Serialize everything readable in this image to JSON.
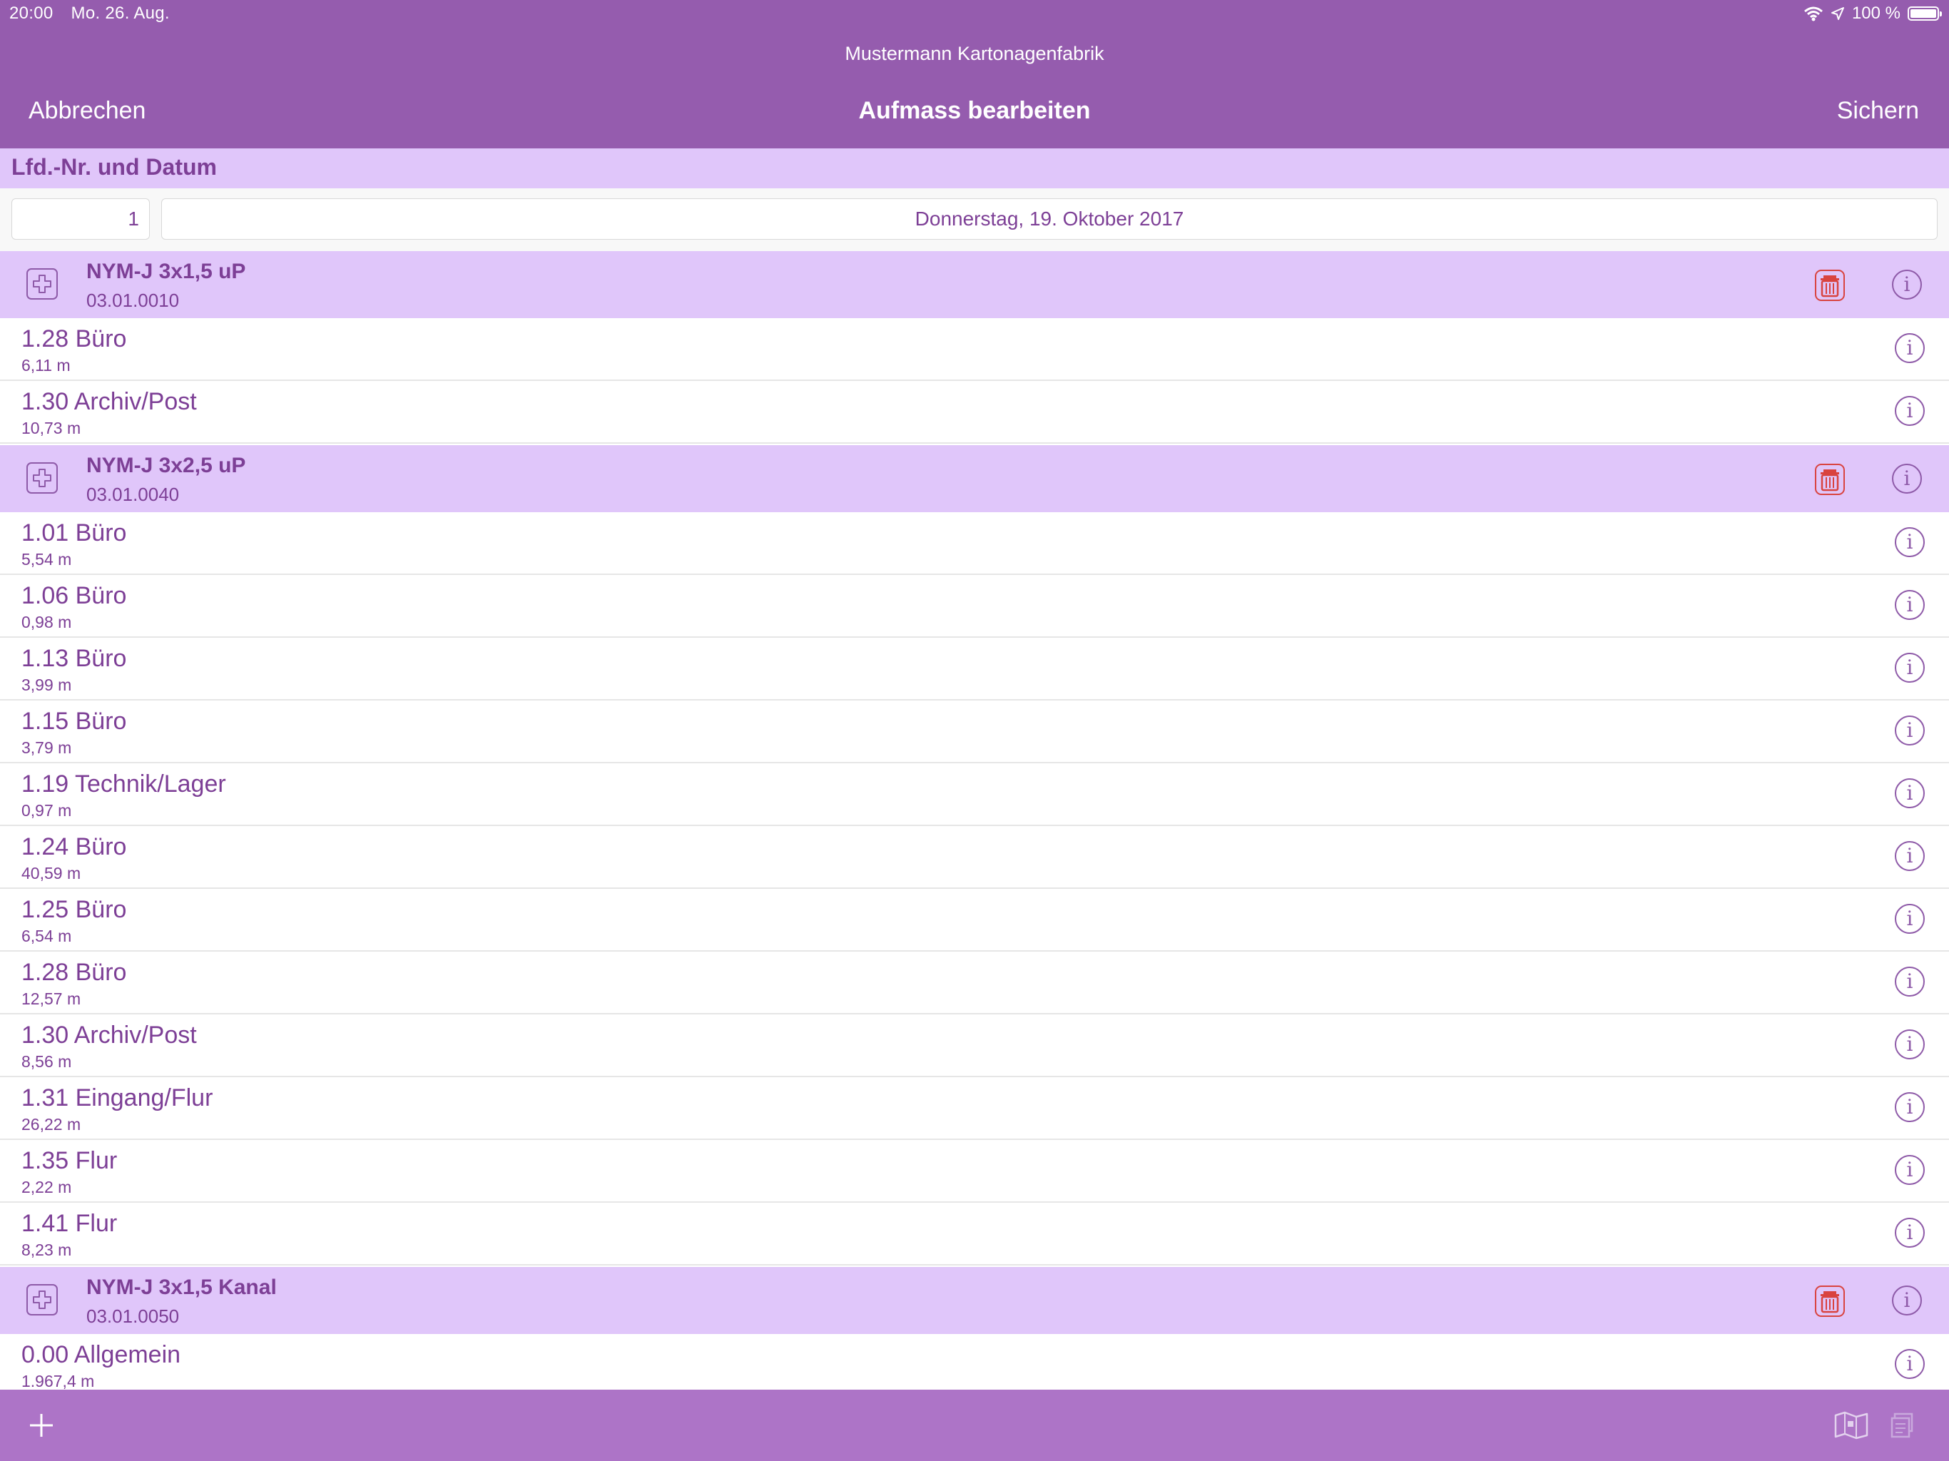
{
  "status_bar": {
    "time": "20:00",
    "date": "Mo. 26. Aug.",
    "battery": "100 %",
    "icons": [
      "wifi-icon",
      "location-icon",
      "battery-icon"
    ]
  },
  "nav": {
    "company": "Mustermann Kartonagenfabrik",
    "title": "Aufmass bearbeiten",
    "cancel": "Abbrechen",
    "save": "Sichern"
  },
  "section": {
    "header": "Lfd.-Nr. und Datum",
    "number": "1",
    "date": "Donnerstag, 19. Oktober 2017"
  },
  "groups": [
    {
      "name": "NYM-J 3x1,5 uP",
      "code": "03.01.0010",
      "items": [
        {
          "name": "1.28 Büro",
          "value": "6,11 m"
        },
        {
          "name": "1.30 Archiv/Post",
          "value": "10,73 m"
        }
      ]
    },
    {
      "name": "NYM-J 3x2,5 uP",
      "code": "03.01.0040",
      "items": [
        {
          "name": "1.01 Büro",
          "value": "5,54 m"
        },
        {
          "name": "1.06 Büro",
          "value": "0,98 m"
        },
        {
          "name": "1.13 Büro",
          "value": "3,99 m"
        },
        {
          "name": "1.15 Büro",
          "value": "3,79 m"
        },
        {
          "name": "1.19 Technik/Lager",
          "value": "0,97 m"
        },
        {
          "name": "1.24 Büro",
          "value": "40,59 m"
        },
        {
          "name": "1.25 Büro",
          "value": "6,54 m"
        },
        {
          "name": "1.28 Büro",
          "value": "12,57 m"
        },
        {
          "name": "1.30 Archiv/Post",
          "value": "8,56 m"
        },
        {
          "name": "1.31 Eingang/Flur",
          "value": "26,22 m"
        },
        {
          "name": "1.35 Flur",
          "value": "2,22 m"
        },
        {
          "name": "1.41 Flur",
          "value": "8,23 m"
        }
      ]
    },
    {
      "name": "NYM-J 3x1,5 Kanal",
      "code": "03.01.0050",
      "items": [
        {
          "name": "0.00 Allgemein",
          "value": "1.967,4 m"
        }
      ]
    }
  ],
  "colors": {
    "bar": "#955cae",
    "section": "#e0c6fa",
    "text": "#7d3f96",
    "toolbar": "#ad74c7",
    "trash": "#d9433f"
  }
}
